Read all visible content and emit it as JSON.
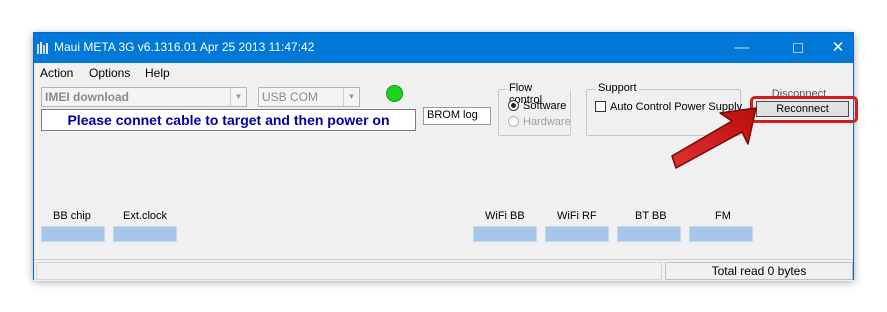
{
  "window": {
    "title": "Maui META 3G v6.1316.01 Apr 25 2013 11:47:42",
    "controls": {
      "minimize": "—",
      "close": "✕"
    }
  },
  "menu": [
    "Action",
    "Options",
    "Help"
  ],
  "connection": {
    "mode": "IMEI download",
    "port": "USB COM",
    "led_color": "#19d419",
    "message": "Please connet cable to target and then power on",
    "brom_log_label": "BROM log"
  },
  "flow_control": {
    "title": "Flow control",
    "software": "Software",
    "hardware": "Hardware"
  },
  "support": {
    "title": "Support",
    "auto_control": "Auto Control Power Supply"
  },
  "buttons": {
    "disconnect": "Disconnect",
    "reconnect": "Reconnect"
  },
  "info_labels": {
    "bb_chip": "BB chip",
    "ext_clock": "Ext.clock",
    "wifi_bb": "WiFi BB",
    "wifi_rf": "WiFi RF",
    "bt_bb": "BT BB",
    "fm": "FM"
  },
  "status": {
    "total_read": "Total read 0 bytes"
  },
  "colors": {
    "titlebar": "#0078d7",
    "highlight": "#d81a1a",
    "info_box": "#a7c6ea",
    "message_text": "#0000a0"
  }
}
